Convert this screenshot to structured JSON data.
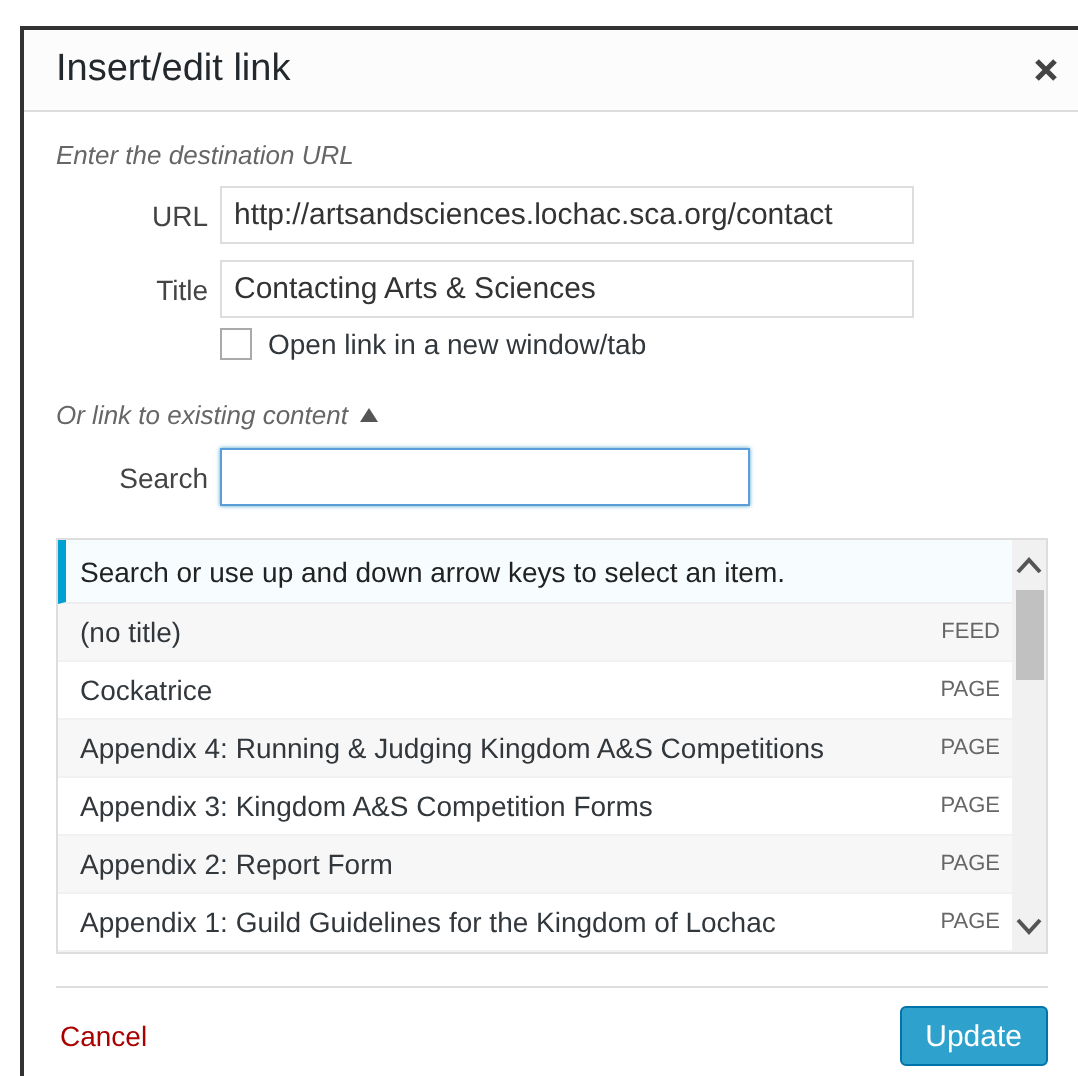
{
  "window": {
    "title": "Insert/edit link"
  },
  "intro": "Enter the destination URL",
  "fields": [
    {
      "label": "URL",
      "value": "http://artsandsciences.lochac.sca.org/contact"
    },
    {
      "label": "Title",
      "value": "Contacting Arts & Sciences"
    }
  ],
  "new_tab": {
    "label": "Open link in a new window/tab",
    "checked": false
  },
  "existing": {
    "label": "Or link to existing content",
    "expanded": true
  },
  "search": {
    "label": "Search",
    "focused": true
  },
  "results": {
    "notice": "Search or use up and down arrow keys to select an item.",
    "items": [
      {
        "title": "(no title)",
        "type": "FEED"
      },
      {
        "title": "Cockatrice",
        "type": "PAGE"
      },
      {
        "title": "Appendix 4: Running & Judging Kingdom A&S Competitions",
        "type": "PAGE"
      },
      {
        "title": "Appendix 3: Kingdom A&S Competition Forms",
        "type": "PAGE"
      },
      {
        "title": "Appendix 2: Report Form",
        "type": "PAGE"
      },
      {
        "title": "Appendix 1: Guild Guidelines for the Kingdom of Lochac",
        "type": "PAGE"
      }
    ]
  },
  "footer": {
    "cancel": "Cancel",
    "submit": "Update"
  }
}
